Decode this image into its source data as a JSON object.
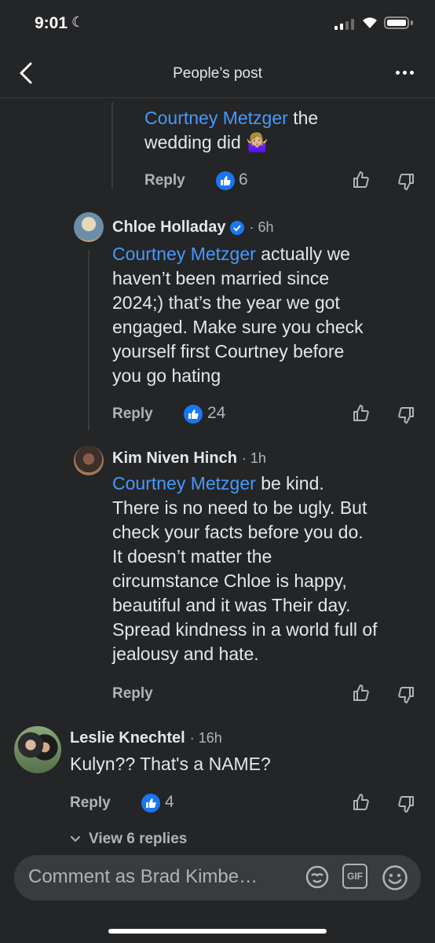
{
  "status_bar": {
    "time": "9:01"
  },
  "header": {
    "title": "People’s post"
  },
  "comment_top": {
    "mention": "Courtney Metzger",
    "text_line1_rest": " the",
    "text_line2": "wedding did 🤷🏼‍♀️",
    "reply_label": "Reply",
    "like_count": "6"
  },
  "comment_chloe": {
    "author": "Chloe Holladay",
    "time": "· 6h",
    "mention": "Courtney Metzger",
    "lines": [
      " actually we",
      "haven’t been married since",
      "2024;) that’s the year we got",
      "engaged. Make sure you check",
      "yourself first Courtney before",
      "you go hating"
    ],
    "reply_label": "Reply",
    "like_count": "24"
  },
  "comment_kim": {
    "author": "Kim Niven Hinch",
    "time": "· 1h",
    "mention": "Courtney Metzger",
    "lines": [
      " be kind.",
      "There is no need to be ugly. But",
      "check your facts before you do.",
      "It doesn’t matter the",
      "circumstance Chloe is happy,",
      "beautiful and it was Their day.",
      "Spread kindness in a world full of",
      "jealousy and hate."
    ],
    "reply_label": "Reply"
  },
  "comment_leslie": {
    "author": "Leslie Knechtel",
    "time": "· 16h",
    "text": "Kulyn?? That's a NAME?",
    "reply_label": "Reply",
    "like_count": "4",
    "view_replies": "View 6 replies"
  },
  "composer": {
    "placeholder": "Comment as Brad Kimbe…",
    "gif_label": "GIF"
  },
  "colors": {
    "accent": "#4599ff",
    "like_blue": "#1877f2",
    "background": "#242527"
  }
}
